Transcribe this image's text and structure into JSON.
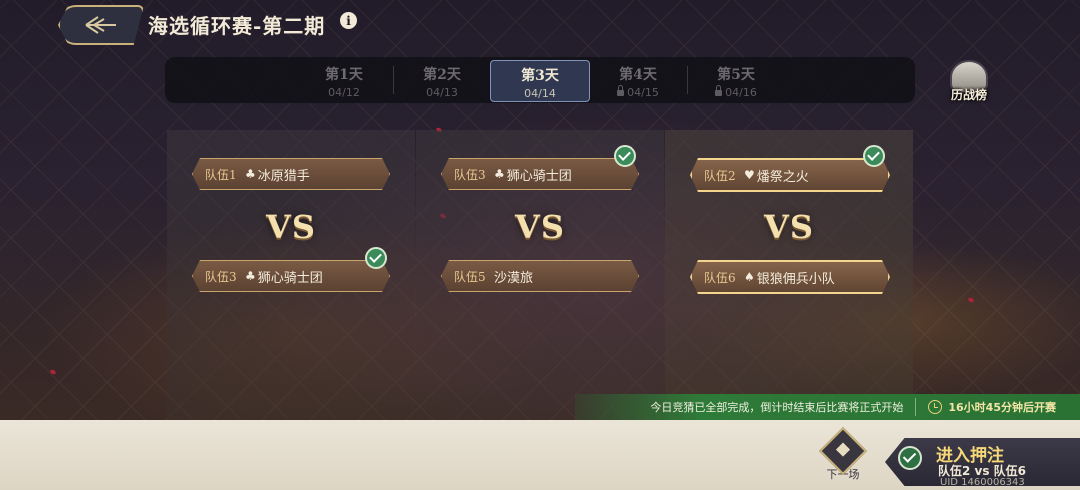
{
  "header": {
    "back_label": "back",
    "title": "海选循环赛-第二期",
    "info_glyph": "i"
  },
  "tabs": [
    {
      "label": "第1天",
      "date": "04/12",
      "locked": false,
      "active": false
    },
    {
      "label": "第2天",
      "date": "04/13",
      "locked": false,
      "active": false
    },
    {
      "label": "第3天",
      "date": "04/14",
      "locked": false,
      "active": true
    },
    {
      "label": "第4天",
      "date": "04/15",
      "locked": true,
      "active": false
    },
    {
      "label": "第5天",
      "date": "04/16",
      "locked": true,
      "active": false
    }
  ],
  "ranking": {
    "label": "历战榜",
    "icon": "helmet-icon"
  },
  "matches": [
    {
      "vs": "VS",
      "team_a": {
        "no": "队伍1",
        "suit": "♣",
        "name": "冰原猎手",
        "picked": false
      },
      "team_b": {
        "no": "队伍3",
        "suit": "♣",
        "name": "狮心骑士团",
        "picked": true
      }
    },
    {
      "vs": "VS",
      "team_a": {
        "no": "队伍3",
        "suit": "♣",
        "name": "狮心骑士团",
        "picked": true
      },
      "team_b": {
        "no": "队伍5",
        "suit": "",
        "name": "沙漠旅",
        "picked": false
      }
    },
    {
      "vs": "VS",
      "team_a": {
        "no": "队伍2",
        "suit": "♥",
        "name": "燔祭之火",
        "picked": true
      },
      "team_b": {
        "no": "队伍6",
        "suit": "♠",
        "name": "银狼佣兵小队",
        "picked": false
      }
    }
  ],
  "banner": {
    "message": "今日竞猜已全部完成，倒计时结束后比赛将正式开始",
    "countdown": "16小时45分钟后开赛"
  },
  "bottom": {
    "next_label": "下一场",
    "bet_title": "进入押注",
    "bet_matchup": "队伍2 vs 队伍6",
    "uid": "UID 1460006343"
  },
  "colors": {
    "accent_gold": "#f3d58e",
    "banner_green": "#2e7a38",
    "active_tab": "#2f3850"
  }
}
